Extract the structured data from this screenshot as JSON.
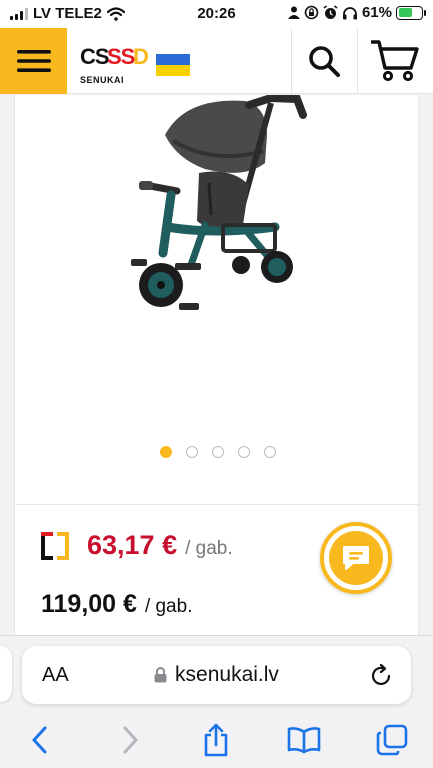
{
  "status_bar": {
    "carrier": "LV TELE2",
    "time": "20:26",
    "battery_percent": "61%",
    "battery_level": 0.61,
    "icons": [
      "signal-icon",
      "wifi-icon",
      "person-icon",
      "lock-rotation-icon",
      "alarm-icon",
      "headphones-icon",
      "battery-charging-icon"
    ]
  },
  "header": {
    "logo_main": "CSSSD",
    "logo_sub": "SENUKAI",
    "menu_icon": "hamburger-menu-icon",
    "search_icon": "search-icon",
    "cart_icon": "shopping-cart-icon",
    "brand_colors": {
      "yellow": "#f9b81e",
      "red": "#e11b22"
    }
  },
  "product": {
    "image_pages": 5,
    "active_image": 1,
    "promo_price": "63,17 €",
    "promo_unit": "/ gab.",
    "regular_price": "119,00 €",
    "regular_unit": "/ gab.",
    "price_color": "#c8102e"
  },
  "chat": {
    "icon": "chat-bubble-icon"
  },
  "safari": {
    "text_size_label": "AA",
    "url": "ksenukai.lv",
    "buttons": [
      "back-icon",
      "forward-icon",
      "share-icon",
      "bookmarks-icon",
      "tabs-icon"
    ]
  }
}
